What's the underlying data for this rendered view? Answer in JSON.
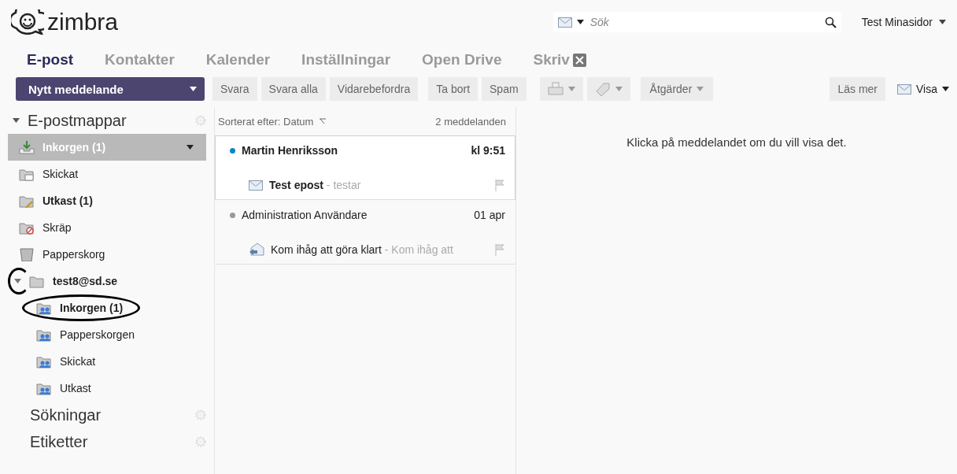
{
  "header": {
    "logo": "zimbra",
    "search": {
      "placeholder": "Sök"
    },
    "user": "Test Minasidor"
  },
  "tabs": [
    {
      "label": "E-post",
      "selected": true,
      "closable": false
    },
    {
      "label": "Kontakter",
      "selected": false,
      "closable": false
    },
    {
      "label": "Kalender",
      "selected": false,
      "closable": false
    },
    {
      "label": "Inställningar",
      "selected": false,
      "closable": false
    },
    {
      "label": "Open Drive",
      "selected": false,
      "closable": false
    },
    {
      "label": "Skriv",
      "selected": false,
      "closable": true
    }
  ],
  "new_message": "Nytt meddelande",
  "toolbar": [
    {
      "kind": "text",
      "label": "Svara"
    },
    {
      "kind": "text",
      "label": "Svara alla"
    },
    {
      "kind": "text",
      "label": "Vidarebefordra"
    },
    {
      "kind": "text",
      "label": "Ta bort"
    },
    {
      "kind": "text",
      "label": "Spam"
    },
    {
      "kind": "print-menu"
    },
    {
      "kind": "tag-menu"
    },
    {
      "kind": "menu",
      "label": "Åtgärder"
    }
  ],
  "toolbar_right": {
    "read_more": "Läs mer",
    "view": "Visa"
  },
  "sidebar": {
    "sections": [
      {
        "title": "E-postmappar",
        "expanded": true,
        "folders": [
          {
            "kind": "inbox",
            "label": "Inkorgen (1)",
            "unread": true,
            "selected": true
          },
          {
            "kind": "sent",
            "label": "Skickat",
            "unread": false,
            "selected": false
          },
          {
            "kind": "drafts",
            "label": "Utkast (1)",
            "unread": true,
            "selected": false
          },
          {
            "kind": "junk",
            "label": "Skräp",
            "unread": false,
            "selected": false
          },
          {
            "kind": "trash",
            "label": "Papperskorg",
            "unread": false,
            "selected": false
          },
          {
            "kind": "account",
            "label": "test8@sd.se",
            "unread": true,
            "selected": false,
            "expanded": true,
            "circled": true,
            "children": [
              {
                "kind": "shared",
                "label": "Inkorgen (1)",
                "unread": true,
                "selected": false,
                "circled": true
              },
              {
                "kind": "shared",
                "label": "Papperskorgen",
                "unread": false,
                "selected": false
              },
              {
                "kind": "shared",
                "label": "Skickat",
                "unread": false,
                "selected": false
              },
              {
                "kind": "shared",
                "label": "Utkast",
                "unread": false,
                "selected": false
              }
            ]
          }
        ]
      },
      {
        "title": "Sökningar"
      },
      {
        "title": "Etiketter"
      }
    ]
  },
  "message_list": {
    "sort": "Sorterat efter: Datum",
    "count": "2 meddelanden",
    "messages": [
      {
        "kind": "envelope",
        "sender": "Martin Henriksson",
        "time": "kl 9:51",
        "subject": "Test epost",
        "preview": " - testar",
        "unread": true,
        "selected": true
      },
      {
        "kind": "replied",
        "sender": "Administration Användare",
        "time": "01 apr",
        "subject": "Kom ihåg att göra klart",
        "preview": " - Kom ihåg att",
        "unread": false,
        "selected": false
      }
    ]
  },
  "reading_pane": {
    "hint": "Klicka på meddelandet om du vill visa det."
  }
}
